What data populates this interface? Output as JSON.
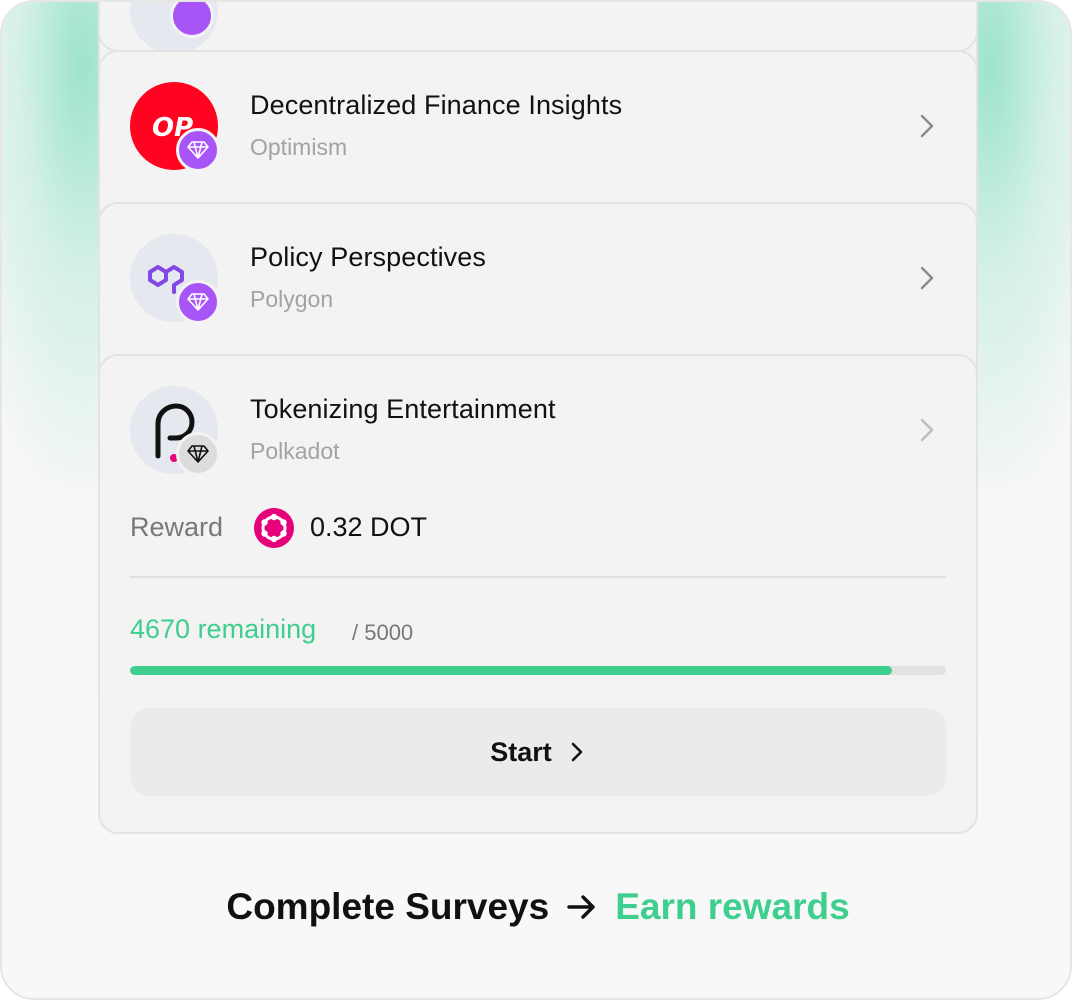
{
  "surveys": [
    {
      "title": "Decentralized Finance Insights",
      "network": "Optimism",
      "logo_text": "OP",
      "logo_color": "#ff0420",
      "badge_color": "#a855f7"
    },
    {
      "title": "Policy Perspectives",
      "network": "Polygon",
      "logo_color": "#8247e5",
      "badge_color": "#a855f7"
    },
    {
      "title": "Tokenizing Entertainment",
      "network": "Polkadot",
      "logo_color": "#e6007a",
      "badge_color": "#dcdcdc",
      "reward_label": "Reward",
      "reward_value": "0.32 DOT",
      "remaining_text": "4670 remaining",
      "total_text": "/ 5000",
      "progress_fraction": 0.934,
      "start_label": "Start"
    }
  ],
  "footer": {
    "left": "Complete Surveys",
    "right": "Earn rewards"
  },
  "colors": {
    "accent_green": "#3ecf8e",
    "badge_purple": "#a855f7"
  },
  "icons": [
    "diamond-icon",
    "chevron-right-icon",
    "arrow-right-icon",
    "optimism-logo",
    "polygon-logo",
    "polkadot-logo"
  ]
}
